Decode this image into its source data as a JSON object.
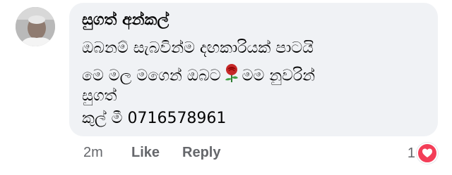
{
  "comment": {
    "author": "සුගත් අන්කල්",
    "lines": [
      "ඔබනම් සැබවින්ම දඟකාරියක් පාටයි",
      "මෙ මල මගෙන් ඔබට",
      "මම නුවරින්",
      "සුගත්",
      "කුල් මී 0716578961"
    ],
    "inline_icon": "rose-icon"
  },
  "actions": {
    "time": "2m",
    "like": "Like",
    "reply": "Reply"
  },
  "reactions": {
    "count": "1",
    "icon": "love-reaction-icon",
    "color": "#f33e58"
  },
  "colors": {
    "bubble": "#f0f2f5",
    "text": "#050505",
    "meta": "#65676b"
  }
}
